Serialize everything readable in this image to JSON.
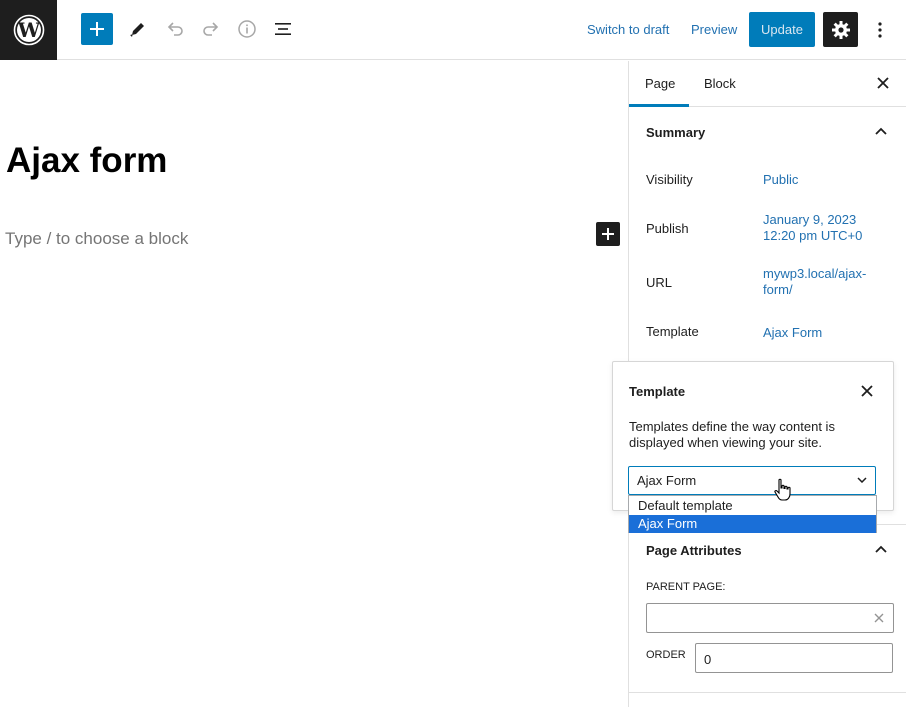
{
  "toolbar": {
    "switch_to_draft": "Switch to draft",
    "preview": "Preview",
    "update": "Update",
    "icons": [
      "wordpress-logo-icon",
      "plus-icon",
      "pencil-icon",
      "undo-icon",
      "redo-icon",
      "info-icon",
      "list-view-icon",
      "gear-icon",
      "more-vertical-icon"
    ]
  },
  "editor": {
    "title": "Ajax form",
    "placeholder": "Type / to choose a block"
  },
  "sidebar": {
    "tabs": [
      {
        "label": "Page",
        "active": true
      },
      {
        "label": "Block",
        "active": false
      }
    ],
    "summary": {
      "title": "Summary",
      "rows": [
        {
          "label": "Visibility",
          "value": "Public"
        },
        {
          "label": "Publish",
          "value_line1": "January 9, 2023",
          "value_line2": "12:20 pm UTC+0"
        },
        {
          "label": "URL",
          "value_line1": "mywp3.local/ajax-",
          "value_line2": "form/"
        },
        {
          "label": "Template",
          "value": "Ajax Form"
        }
      ]
    },
    "page_attributes": {
      "title": "Page Attributes",
      "parent_label": "PARENT PAGE:",
      "parent_value": "",
      "order_label": "ORDER",
      "order_value": "0"
    }
  },
  "template_popover": {
    "title": "Template",
    "description": "Templates define the way content is displayed when viewing your site.",
    "selected": "Ajax Form",
    "options": [
      "Default template",
      "Ajax Form"
    ]
  },
  "colors": {
    "accent": "#007cba",
    "link": "#2271b1",
    "dark": "#1e1e1e",
    "selected_option": "#1a6fd8"
  }
}
